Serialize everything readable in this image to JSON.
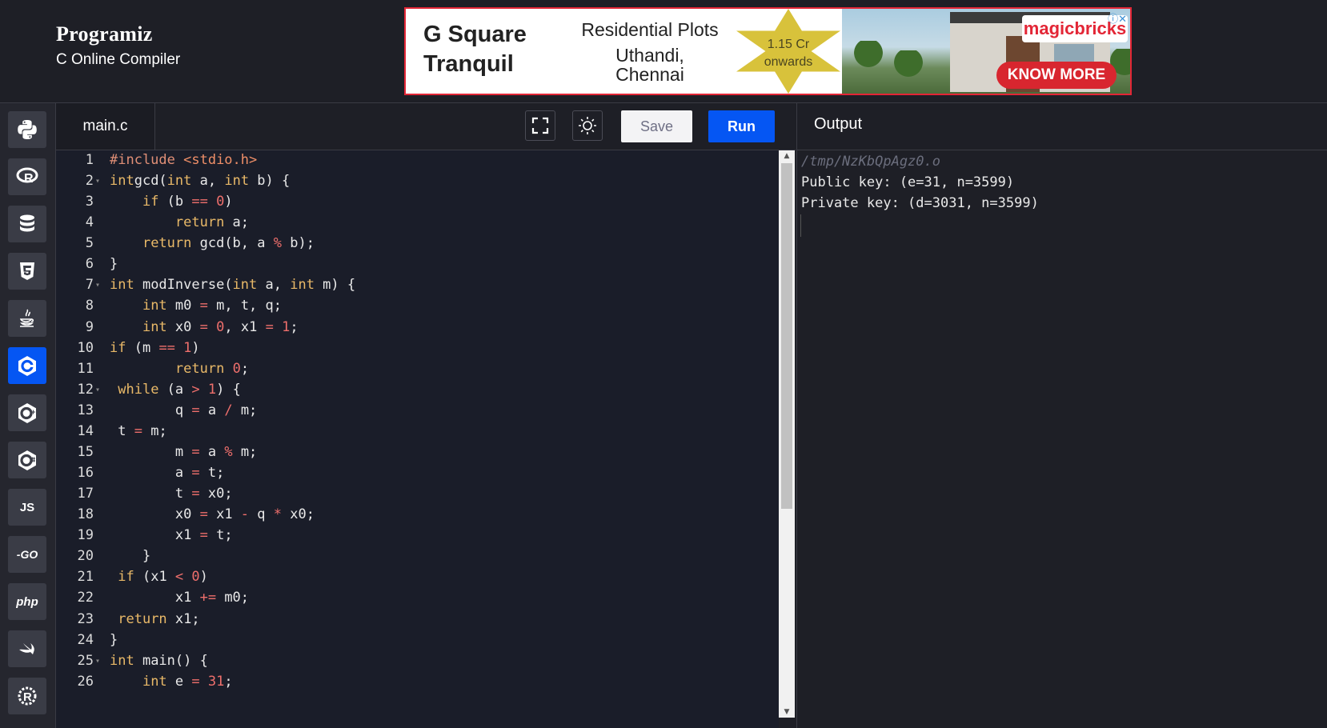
{
  "brand": {
    "logo_text": "Programiz",
    "subtitle": "C Online Compiler"
  },
  "ad": {
    "project": [
      "G Square",
      "Tranquil"
    ],
    "headline": "Residential Plots",
    "location": [
      "Uthandi,",
      "Chennai"
    ],
    "price": [
      "1.15 Cr",
      "onwards"
    ],
    "brand": "magicbricks",
    "cta": "KNOW MORE"
  },
  "languages": [
    {
      "id": "python",
      "label": "Py"
    },
    {
      "id": "r",
      "label": "R"
    },
    {
      "id": "sql",
      "label": "SQL"
    },
    {
      "id": "html",
      "label": "5"
    },
    {
      "id": "java",
      "label": "Java"
    },
    {
      "id": "c",
      "label": "C",
      "active": true
    },
    {
      "id": "cpp",
      "label": "C++"
    },
    {
      "id": "csharp",
      "label": "C#"
    },
    {
      "id": "js",
      "label": "JS"
    },
    {
      "id": "go",
      "label": "GO"
    },
    {
      "id": "php",
      "label": "php"
    },
    {
      "id": "swift",
      "label": "Swift"
    },
    {
      "id": "rust",
      "label": "R"
    }
  ],
  "editor": {
    "tab_name": "main.c",
    "save_label": "Save",
    "run_label": "Run",
    "lines": [
      {
        "n": "1",
        "fold": false,
        "tokens": [
          [
            "inc",
            "#include "
          ],
          [
            "incstr",
            "<stdio.h>"
          ]
        ]
      },
      {
        "n": "2",
        "fold": true,
        "tokens": [
          [
            "kw",
            "int"
          ],
          [
            "",
            "gcd("
          ],
          [
            "kw",
            "int"
          ],
          [
            "",
            " a, "
          ],
          [
            "kw",
            "int"
          ],
          [
            "",
            " b) {"
          ]
        ]
      },
      {
        "n": "3",
        "fold": false,
        "tokens": [
          [
            "",
            "    "
          ],
          [
            "kw",
            "if"
          ],
          [
            "",
            " (b "
          ],
          [
            "op",
            "=="
          ],
          [
            "",
            " "
          ],
          [
            "num",
            "0"
          ],
          [
            "",
            ")"
          ]
        ]
      },
      {
        "n": "4",
        "fold": false,
        "tokens": [
          [
            "",
            "        "
          ],
          [
            "kw",
            "return"
          ],
          [
            "",
            " a;"
          ]
        ]
      },
      {
        "n": "5",
        "fold": false,
        "tokens": [
          [
            "",
            "    "
          ],
          [
            "kw",
            "return"
          ],
          [
            "",
            " gcd(b, a "
          ],
          [
            "op",
            "%"
          ],
          [
            "",
            " b);"
          ]
        ]
      },
      {
        "n": "6",
        "fold": false,
        "tokens": [
          [
            "",
            "}"
          ]
        ]
      },
      {
        "n": "7",
        "fold": true,
        "tokens": [
          [
            "kw",
            "int"
          ],
          [
            "",
            " modInverse("
          ],
          [
            "kw",
            "int"
          ],
          [
            "",
            " a, "
          ],
          [
            "kw",
            "int"
          ],
          [
            "",
            " m) {"
          ]
        ]
      },
      {
        "n": "8",
        "fold": false,
        "tokens": [
          [
            "",
            "    "
          ],
          [
            "kw",
            "int"
          ],
          [
            "",
            " m0 "
          ],
          [
            "op",
            "="
          ],
          [
            "",
            " m, t, q;"
          ]
        ]
      },
      {
        "n": "9",
        "fold": false,
        "tokens": [
          [
            "",
            "    "
          ],
          [
            "kw",
            "int"
          ],
          [
            "",
            " x0 "
          ],
          [
            "op",
            "="
          ],
          [
            "",
            " "
          ],
          [
            "num",
            "0"
          ],
          [
            "",
            ", x1 "
          ],
          [
            "op",
            "="
          ],
          [
            "",
            " "
          ],
          [
            "num",
            "1"
          ],
          [
            "",
            ";"
          ]
        ]
      },
      {
        "n": "10",
        "fold": false,
        "tokens": [
          [
            "kw",
            "if"
          ],
          [
            "",
            " (m "
          ],
          [
            "op",
            "=="
          ],
          [
            "",
            " "
          ],
          [
            "num",
            "1"
          ],
          [
            "",
            ")"
          ]
        ]
      },
      {
        "n": "11",
        "fold": false,
        "tokens": [
          [
            "",
            "        "
          ],
          [
            "kw",
            "return"
          ],
          [
            "",
            " "
          ],
          [
            "num",
            "0"
          ],
          [
            "",
            ";"
          ]
        ]
      },
      {
        "n": "12",
        "fold": true,
        "tokens": [
          [
            "",
            " "
          ],
          [
            "kw",
            "while"
          ],
          [
            "",
            " (a "
          ],
          [
            "op",
            ">"
          ],
          [
            "",
            " "
          ],
          [
            "num",
            "1"
          ],
          [
            "",
            ") {"
          ]
        ]
      },
      {
        "n": "13",
        "fold": false,
        "tokens": [
          [
            "",
            "        q "
          ],
          [
            "op",
            "="
          ],
          [
            "",
            " a "
          ],
          [
            "op",
            "/"
          ],
          [
            "",
            " m;"
          ]
        ]
      },
      {
        "n": "14",
        "fold": false,
        "tokens": [
          [
            "",
            " t "
          ],
          [
            "op",
            "="
          ],
          [
            "",
            " m;"
          ]
        ]
      },
      {
        "n": "15",
        "fold": false,
        "tokens": [
          [
            "",
            "        m "
          ],
          [
            "op",
            "="
          ],
          [
            "",
            " a "
          ],
          [
            "op",
            "%"
          ],
          [
            "",
            " m;"
          ]
        ]
      },
      {
        "n": "16",
        "fold": false,
        "tokens": [
          [
            "",
            "        a "
          ],
          [
            "op",
            "="
          ],
          [
            "",
            " t;"
          ]
        ]
      },
      {
        "n": "17",
        "fold": false,
        "tokens": [
          [
            "",
            "        t "
          ],
          [
            "op",
            "="
          ],
          [
            "",
            " x0;"
          ]
        ]
      },
      {
        "n": "18",
        "fold": false,
        "tokens": [
          [
            "",
            "        x0 "
          ],
          [
            "op",
            "="
          ],
          [
            "",
            " x1 "
          ],
          [
            "op",
            "-"
          ],
          [
            "",
            " q "
          ],
          [
            "op",
            "*"
          ],
          [
            "",
            " x0;"
          ]
        ]
      },
      {
        "n": "19",
        "fold": false,
        "tokens": [
          [
            "",
            "        x1 "
          ],
          [
            "op",
            "="
          ],
          [
            "",
            " t;"
          ]
        ]
      },
      {
        "n": "20",
        "fold": false,
        "tokens": [
          [
            "",
            "    }"
          ]
        ]
      },
      {
        "n": "21",
        "fold": false,
        "tokens": [
          [
            "",
            " "
          ],
          [
            "kw",
            "if"
          ],
          [
            "",
            " (x1 "
          ],
          [
            "op",
            "<"
          ],
          [
            "",
            " "
          ],
          [
            "num",
            "0"
          ],
          [
            "",
            ")"
          ]
        ]
      },
      {
        "n": "22",
        "fold": false,
        "tokens": [
          [
            "",
            "        x1 "
          ],
          [
            "op",
            "+="
          ],
          [
            "",
            " m0;"
          ]
        ]
      },
      {
        "n": "23",
        "fold": false,
        "tokens": [
          [
            "",
            " "
          ],
          [
            "kw",
            "return"
          ],
          [
            "",
            " x1;"
          ]
        ]
      },
      {
        "n": "24",
        "fold": false,
        "tokens": [
          [
            "",
            "}"
          ]
        ]
      },
      {
        "n": "25",
        "fold": true,
        "tokens": [
          [
            "kw",
            "int"
          ],
          [
            "",
            " main() {"
          ]
        ]
      },
      {
        "n": "26",
        "fold": false,
        "tokens": [
          [
            "",
            "    "
          ],
          [
            "kw",
            "int"
          ],
          [
            "",
            " e "
          ],
          [
            "op",
            "="
          ],
          [
            "",
            " "
          ],
          [
            "num",
            "31"
          ],
          [
            "",
            ";"
          ]
        ]
      }
    ]
  },
  "output": {
    "title": "Output",
    "lines": [
      {
        "text": "/tmp/NzKbQpAgz0.o",
        "style": "path"
      },
      {
        "text": "Public key: (e=31, n=3599)",
        "style": ""
      },
      {
        "text": "Private key: (d=3031, n=3599)",
        "style": ""
      }
    ]
  },
  "colors": {
    "accent": "#0556f3",
    "background": "#1e1f26",
    "editor_bg": "#1a1d29",
    "keyword": "#e9b968",
    "number": "#ef6f6c"
  }
}
